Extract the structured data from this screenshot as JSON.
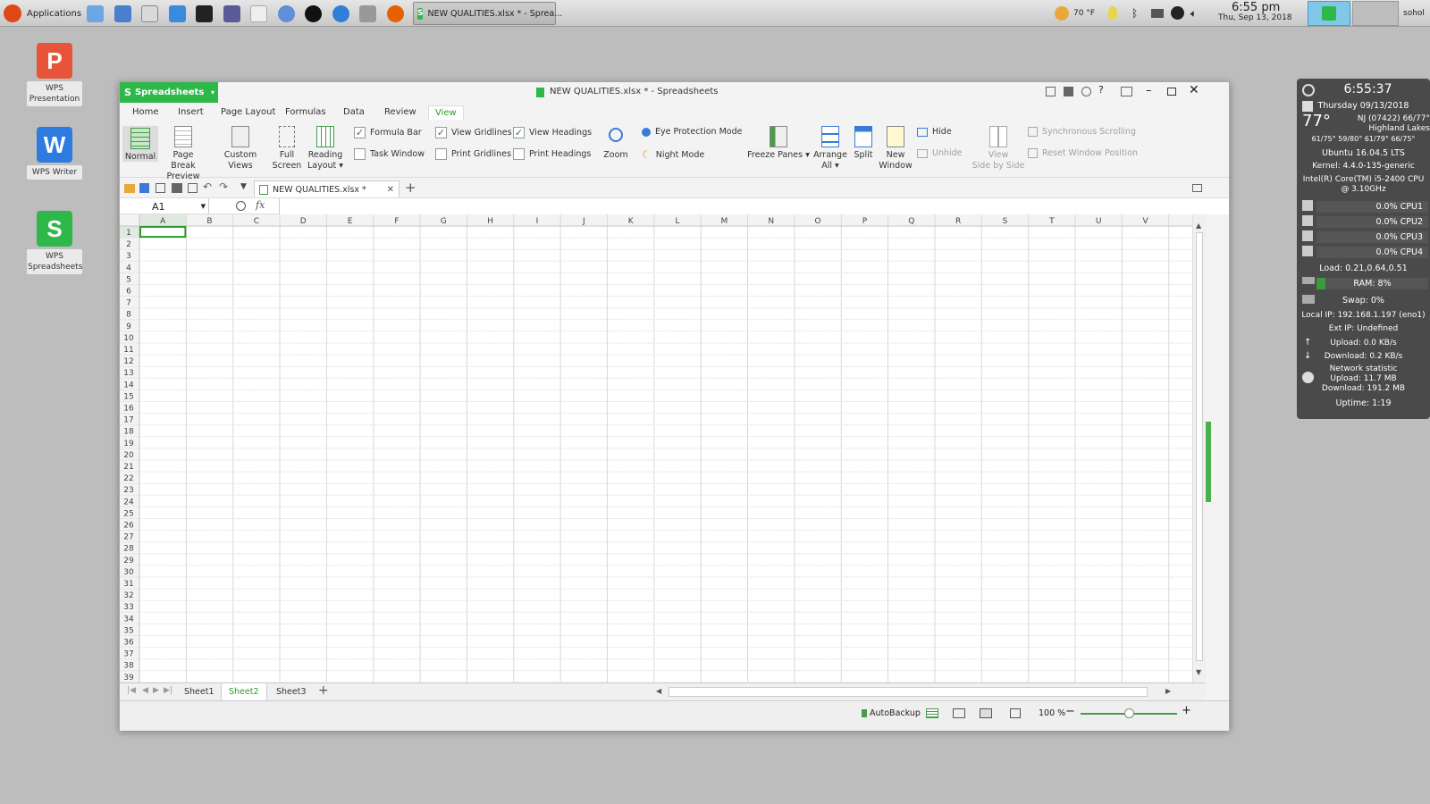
{
  "taskbar": {
    "apps_label": "Applications",
    "task_title": "NEW QUALITIES.xlsx * - Sprea...",
    "weather_temp": "70 °F",
    "clock_time": "6:55 pm",
    "clock_date": "Thu, Sep 13, 2018",
    "user": "sohol"
  },
  "desktop": {
    "icons": [
      {
        "label": "WPS Presentation",
        "letter": "P",
        "color": "#e8543a"
      },
      {
        "label": "WPS Writer",
        "letter": "W",
        "color": "#2e7be0"
      },
      {
        "label": "WPS Spreadsheets",
        "letter": "S",
        "color": "#2eb84a"
      }
    ]
  },
  "window": {
    "app_button": "Spreadsheets",
    "title": "NEW QUALITIES.xlsx * - Spreadsheets",
    "menu_tabs": [
      "Home",
      "Insert",
      "Page Layout",
      "Formulas",
      "Data",
      "Review",
      "View"
    ],
    "active_tab": "View",
    "ribbon": {
      "normal": "Normal",
      "page_break_1": "Page Break",
      "page_break_2": "Preview",
      "custom_views": "Custom Views",
      "full_screen_1": "Full",
      "full_screen_2": "Screen",
      "reading_layout_1": "Reading",
      "reading_layout_2": "Layout",
      "formula_bar": "Formula Bar",
      "task_window": "Task Window",
      "view_gridlines": "View Gridlines",
      "print_gridlines": "Print Gridlines",
      "view_headings": "View Headings",
      "print_headings": "Print Headings",
      "zoom": "Zoom",
      "eye_protection": "Eye Protection Mode",
      "night_mode": "Night Mode",
      "freeze_panes": "Freeze Panes",
      "arrange_all_1": "Arrange",
      "arrange_all_2": "All",
      "split": "Split",
      "new_window_1": "New",
      "new_window_2": "Window",
      "hide": "Hide",
      "unhide": "Unhide",
      "side_by_side_1": "View",
      "side_by_side_2": "Side by Side",
      "sync_scrolling": "Synchronous Scrolling",
      "reset_position": "Reset Window Position"
    },
    "doc_tab": "NEW QUALITIES.xlsx *",
    "name_box": "A1",
    "fx": "fx",
    "columns": [
      "A",
      "B",
      "C",
      "D",
      "E",
      "F",
      "G",
      "H",
      "I",
      "J",
      "K",
      "L",
      "M",
      "N",
      "O",
      "P",
      "Q",
      "R",
      "S",
      "T",
      "U",
      "V"
    ],
    "rows": [
      "1",
      "2",
      "3",
      "4",
      "5",
      "6",
      "7",
      "8",
      "9",
      "10",
      "11",
      "12",
      "13",
      "14",
      "15",
      "16",
      "17",
      "18",
      "19",
      "20",
      "21",
      "22",
      "23",
      "24",
      "25",
      "26",
      "27",
      "28",
      "29",
      "30",
      "31",
      "32",
      "33",
      "34",
      "35",
      "36",
      "37",
      "38",
      "39"
    ],
    "sheets": [
      "Sheet1",
      "Sheet2",
      "Sheet3"
    ],
    "active_sheet": "Sheet2",
    "status": {
      "autobackup": "AutoBackup",
      "zoom": "100 %"
    }
  },
  "conky": {
    "time": "6:55:37",
    "date": "Thursday 09/13/2018",
    "temp": "77°",
    "location_1": "NJ (07422) 66/77°",
    "location_2": "Highland Lakes",
    "forecast": "61/75° 59/80° 61/79° 66/75°",
    "os": "Ubuntu 16.04.5 LTS",
    "kernel": "Kernel: 4.4.0-135-generic",
    "cpu_model_1": "Intel(R) Core(TM) i5-2400 CPU",
    "cpu_model_2": "@ 3.10GHz",
    "cpus": [
      "0.0% CPU1",
      "0.0% CPU2",
      "0.0% CPU3",
      "0.0% CPU4"
    ],
    "load": "Load: 0.21,0.64,0.51",
    "ram": "RAM: 8%",
    "swap": "Swap: 0%",
    "local_ip": "Local IP: 192.168.1.197 (eno1)",
    "ext_ip": "Ext IP: Undefined",
    "upload": "Upload: 0.0 KB/s",
    "download": "Download: 0.2 KB/s",
    "net_stat": "Network statistic",
    "net_up": "Upload: 11.7 MB",
    "net_down": "Download: 191.2 MB",
    "uptime": "Uptime: 1:19"
  },
  "colors": {
    "accent": "#2eb84a",
    "view_tab": "#2e9a2e"
  }
}
